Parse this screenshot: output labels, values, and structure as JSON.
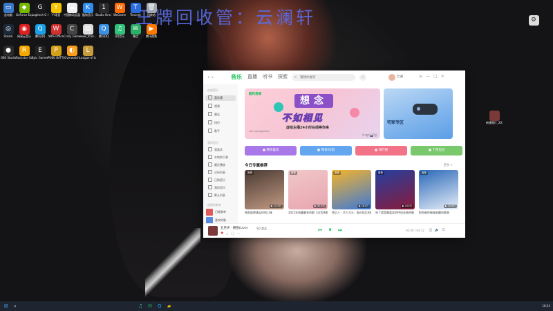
{
  "desktop": {
    "banner_text": "王牌回收管：云澜轩",
    "icons": [
      {
        "label": "此电脑",
        "icon": "computer-icon",
        "color": "#3a78c8",
        "glyph": "▭"
      },
      {
        "label": "GeForce Experience",
        "icon": "geforce-icon",
        "color": "#76b900",
        "glyph": "◆"
      },
      {
        "label": "Logitech G HUB",
        "icon": "logitech-icon",
        "color": "#1a1a1a",
        "glyph": "G"
      },
      {
        "label": "YY语音",
        "icon": "yy-icon",
        "color": "#f5c400",
        "glyph": "Y"
      },
      {
        "label": "中国移动云盘",
        "icon": "cloud-icon",
        "color": "#f0f0f0",
        "glyph": "☁"
      },
      {
        "label": "酷狗音乐",
        "icon": "kugou-icon",
        "color": "#2f8cf0",
        "glyph": "K"
      },
      {
        "label": "Studio One 3.0专业版",
        "icon": "studio-one-icon",
        "color": "#2a2a2a",
        "glyph": "1"
      },
      {
        "label": "WeGame",
        "icon": "wegame-icon",
        "color": "#ff6a00",
        "glyph": "W"
      },
      {
        "label": "Tencent",
        "icon": "tencent-icon",
        "color": "#2b6de0",
        "glyph": "T"
      },
      {
        "label": "回收站",
        "icon": "recycle-bin-icon",
        "color": "#a0a8b0",
        "glyph": "🗑"
      },
      {
        "label": "Steam",
        "icon": "steam-icon",
        "color": "#1b2838",
        "glyph": "◎"
      },
      {
        "label": "网易云音乐",
        "icon": "netease-icon",
        "color": "#e02020",
        "glyph": "◉"
      },
      {
        "label": "腾讯QQ",
        "icon": "qq-icon",
        "color": "#1aa0e8",
        "glyph": "Q"
      },
      {
        "label": "WPS Office",
        "icon": "wps-icon",
        "color": "#d32f2f",
        "glyph": "W"
      },
      {
        "label": "Crazy Games",
        "icon": "crazy-icon",
        "color": "#444",
        "glyph": "C"
      },
      {
        "label": "www_tcad...",
        "icon": "file-icon",
        "color": "#ddd",
        "glyph": "▤"
      },
      {
        "label": "腾讯QQ",
        "icon": "qq2-icon",
        "color": "#3a8fe0",
        "glyph": "Q"
      },
      {
        "label": "QQ音乐",
        "icon": "qqmusic-icon",
        "color": "#31c27c",
        "glyph": "♫"
      },
      {
        "label": "微信",
        "icon": "wechat-icon",
        "color": "#2aae67",
        "glyph": "✉"
      },
      {
        "label": "腾讯视频",
        "icon": "tencent-video-icon",
        "color": "#ff7800",
        "glyph": "▶"
      },
      {
        "label": "OBS Studio",
        "icon": "obs-icon",
        "color": "#2a2a2a",
        "glyph": "●"
      },
      {
        "label": "Rockstar Games",
        "icon": "rockstar-icon",
        "color": "#f5a800",
        "glyph": "R"
      },
      {
        "label": "Epic Games Launcher",
        "icon": "epic-icon",
        "color": "#222",
        "glyph": "E"
      },
      {
        "label": "PUBG BATTLEGROUNDS",
        "icon": "pubg-icon",
        "color": "#d4a017",
        "glyph": "P"
      },
      {
        "label": "Overwatch",
        "icon": "overwatch-icon",
        "color": "#f99e1a",
        "glyph": "◐"
      },
      {
        "label": "League of Legends",
        "icon": "lol-icon",
        "color": "#c89b3c",
        "glyph": "L"
      }
    ],
    "right_icon_label": "新建图片_2022..."
  },
  "app": {
    "tabs": [
      "音乐",
      "直播",
      "听书",
      "探索"
    ],
    "active_tab": "音乐",
    "search_placeholder": "猜猜你喜欢",
    "user_name": "云澜",
    "window_buttons": [
      "≡",
      "—",
      "□",
      "✕"
    ],
    "sidebar": {
      "section_online": "在线音乐",
      "items": [
        "音乐馆",
        "视频",
        "雷达",
        "排行",
        "歌手"
      ],
      "section_mine": "我的音乐",
      "my_items": [
        "我喜欢",
        "本地和下载",
        "最近播放",
        "试听列表",
        "已购音乐",
        "我的音乐",
        "默认列表"
      ],
      "section_created": "创建的歌单",
      "playlists": [
        "日推歌单",
        "喜欢的歌"
      ]
    },
    "banner": {
      "logo_text": "酷狗直播",
      "title_1": "想念",
      "title_2": "不如相见",
      "subtitle": "虚拟主播24小时在线等你来",
      "date_text": "August 2022",
      "small_text": "Let's go together",
      "side_title": "宅家专区"
    },
    "quick_buttons": [
      {
        "label": "猜你喜欢",
        "color": "#a878e8"
      },
      {
        "label": "每日30首",
        "color": "#62a6f0"
      },
      {
        "label": "排行榜",
        "color": "#f27288"
      },
      {
        "label": "个性电台",
        "color": "#7ac86c"
      }
    ],
    "recommend_title": "今日专属推荐",
    "recommend_more": "更多 >",
    "cards": [
      {
        "title": "独家旋律满足你的口味",
        "plays": "14.5万",
        "tag": "推荐",
        "c1": "#4a3a32",
        "c2": "#c29a84"
      },
      {
        "title": "2022年收藏最多的歌 | 抖音热歌",
        "plays": "33.9万",
        "tag": "推荐",
        "c1": "#f0c8c8",
        "c2": "#e8a4b0"
      },
      {
        "title": "然后人 · 华人大众 · 面对现实的歌",
        "plays": "181万",
        "tag": "推荐",
        "c1": "#f6b42a",
        "c2": "#3c78d8"
      },
      {
        "title": "听了就是最喜欢的怀旧金曲合集",
        "plays": "100万",
        "tag": "推荐",
        "c1": "#2440a0",
        "c2": "#8a1a3a"
      },
      {
        "title": "那些被你偷偷收藏的歌曲",
        "plays": "35.8万",
        "tag": "推荐",
        "c1": "#2a68b8",
        "c2": "#e6eef8"
      }
    ],
    "player": {
      "song": "五月天 · 拥抱(Live)",
      "vip_text": "SQ 超品",
      "time": "00:00 / 04:12"
    }
  },
  "taskbar": {
    "clock": "18:54"
  }
}
